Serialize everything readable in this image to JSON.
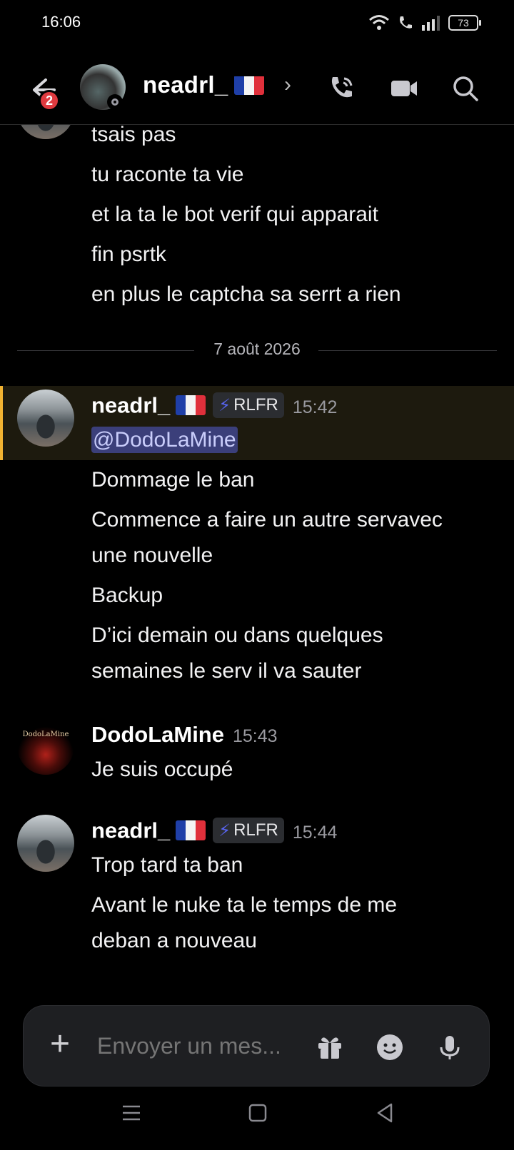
{
  "status_bar": {
    "time": "16:06",
    "battery": "73"
  },
  "header": {
    "back_badge": "2",
    "username": "neadrl_"
  },
  "messages_top": [
    "tsais pas",
    "tu raconte ta vie",
    "et la ta le bot verif qui apparait",
    "fin psrtk",
    "en plus le captcha sa serrt a rien"
  ],
  "date_divider": "7 août 2026",
  "groups": [
    {
      "author": "neadrl_",
      "tag": "RLFR",
      "time": "15:42",
      "mention": "@DodoLaMine",
      "lines": [
        "Dommage le ban",
        "Commence a faire un autre servavec",
        "une nouvelle",
        "Backup",
        "D’ici demain ou dans quelques",
        "semaines le serv il va sauter"
      ]
    },
    {
      "author": "DodoLaMine",
      "avatar_text": "DodoLaMine",
      "time": "15:43",
      "lines": [
        "Je suis occupé"
      ]
    },
    {
      "author": "neadrl_",
      "tag": "RLFR",
      "time": "15:44",
      "lines": [
        "Trop tard ta ban",
        "Avant le nuke ta le temps de me",
        "deban a nouveau"
      ]
    }
  ],
  "composer": {
    "placeholder": "Envoyer un mes..."
  },
  "colors": {
    "accent": "#5865f2",
    "highlight_bar": "#f0b232",
    "badge": "#e03a3f",
    "mention_bg": "#3b3f7a"
  }
}
